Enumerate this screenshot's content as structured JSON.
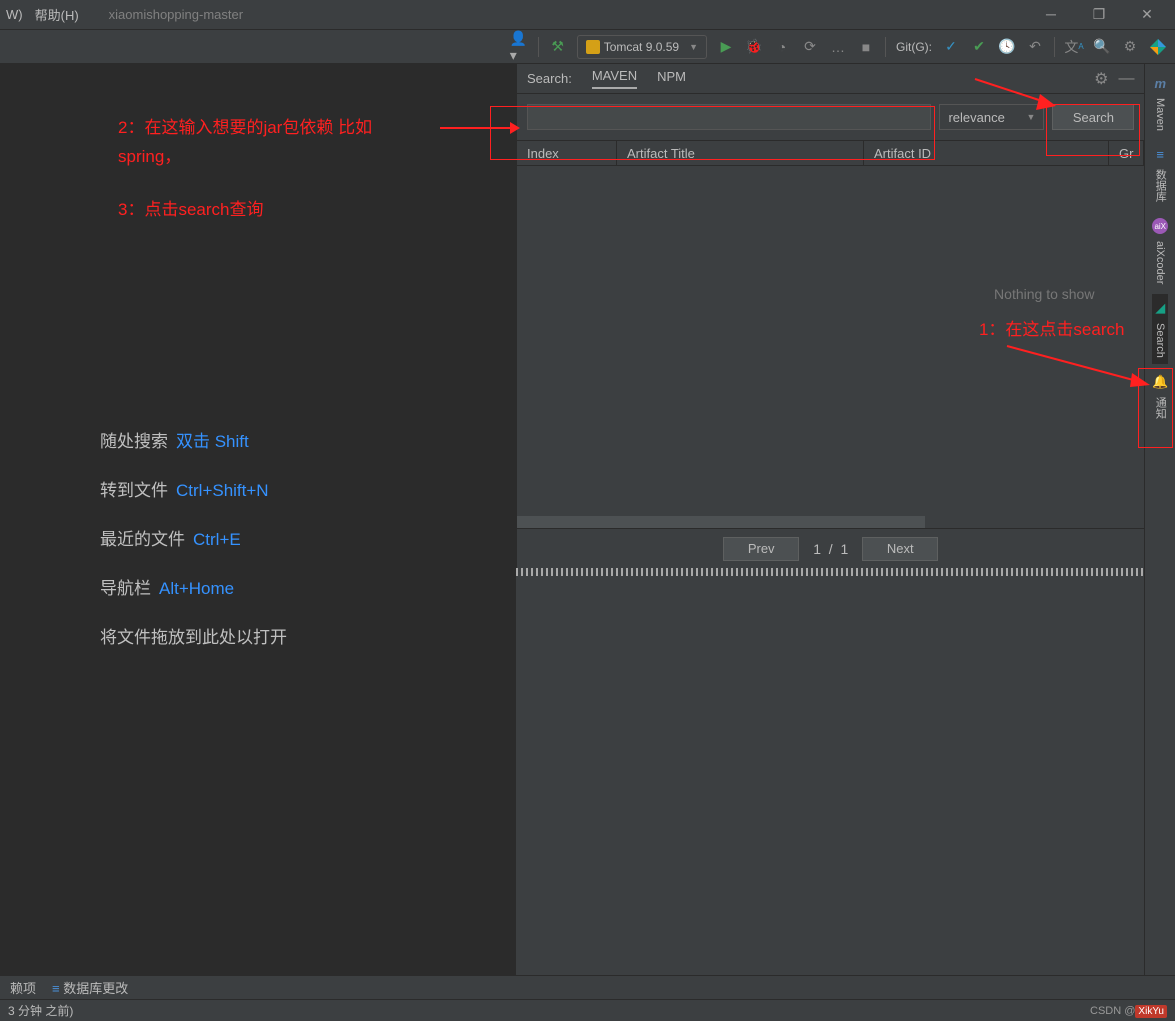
{
  "titlebar": {
    "menu_trunc": "W)",
    "help_label": "帮助(H)",
    "project_name": "xiaomishopping-master"
  },
  "toolbar": {
    "tomcat_label": "Tomcat 9.0.59",
    "git_label": "Git(G):"
  },
  "annotations": {
    "step2_line1": "2：在这输入想要的jar包依赖  比如",
    "step2_line2": "spring，",
    "step3": "3：点击search查询",
    "step1": "1：在这点击search"
  },
  "nav_hints": [
    {
      "label": "随处搜索",
      "shortcut": "双击 Shift"
    },
    {
      "label": "转到文件",
      "shortcut": "Ctrl+Shift+N"
    },
    {
      "label": "最近的文件",
      "shortcut": "Ctrl+E"
    },
    {
      "label": "导航栏",
      "shortcut": "Alt+Home"
    }
  ],
  "nav_drop_hint": "将文件拖放到此处以打开",
  "search_panel": {
    "search_label": "Search:",
    "tabs": [
      "MAVEN",
      "NPM"
    ],
    "active_tab": "MAVEN",
    "input_value": "",
    "sort_value": "relevance",
    "search_button": "Search",
    "columns": {
      "index": "Index",
      "title": "Artifact Title",
      "id": "Artifact ID",
      "group": "Gr"
    },
    "nothing_text": "Nothing to show",
    "prev": "Prev",
    "next": "Next",
    "page_current": "1",
    "page_sep": "/",
    "page_total": "1"
  },
  "right_sidebar": {
    "items": [
      {
        "icon": "m",
        "label": "Maven",
        "icon_color": "#5b7fa6"
      },
      {
        "icon": "≡",
        "label": "数据库",
        "icon_color": "#4a90d9"
      },
      {
        "icon": "●",
        "label": "aiXcoder",
        "icon_color": "#9b59b6"
      },
      {
        "icon": "⌕",
        "label": "Search",
        "icon_color": "#16a085"
      },
      {
        "icon": "🔔",
        "label": "通知",
        "icon_color": "#888"
      }
    ]
  },
  "bottom_bar": {
    "item1": "赖项",
    "item2": "数据库更改"
  },
  "status_bar": {
    "left": "3 分钟 之前)",
    "watermark_prefix": "CSDN @",
    "watermark_user": "XikYu"
  }
}
